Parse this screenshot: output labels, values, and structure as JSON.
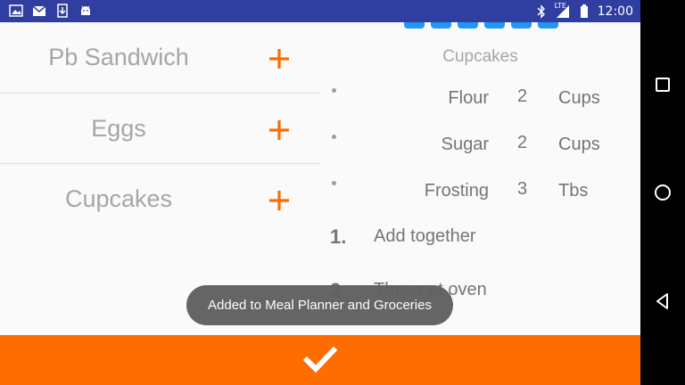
{
  "status_bar": {
    "time": "12:00",
    "network": "LTE",
    "left_icons": [
      "image-icon",
      "mail-icon",
      "download-icon",
      "android-icon"
    ],
    "right_icons": [
      "bluetooth-icon",
      "signal-icon",
      "battery-icon"
    ]
  },
  "meals": [
    {
      "name": "Pb Sandwich"
    },
    {
      "name": "Eggs"
    },
    {
      "name": "Cupcakes"
    }
  ],
  "recipe": {
    "title": "Cupcakes",
    "ingredients": [
      {
        "name": "Flour",
        "qty": "2",
        "unit": "Cups"
      },
      {
        "name": "Sugar",
        "qty": "2",
        "unit": "Cups"
      },
      {
        "name": "Frosting",
        "qty": "3",
        "unit": "Tbs"
      }
    ],
    "steps": [
      {
        "num": "1.",
        "text": "Add together"
      },
      {
        "num": "2.",
        "text": "Throw at oven"
      }
    ]
  },
  "toast": {
    "text": "Added to Meal Planner and Groceries"
  },
  "colors": {
    "accent": "#ff6d00",
    "status_bar": "#303f9f",
    "page_indicator": "#2196f3"
  },
  "nav": [
    "square-icon",
    "circle-icon",
    "back-triangle-icon"
  ]
}
